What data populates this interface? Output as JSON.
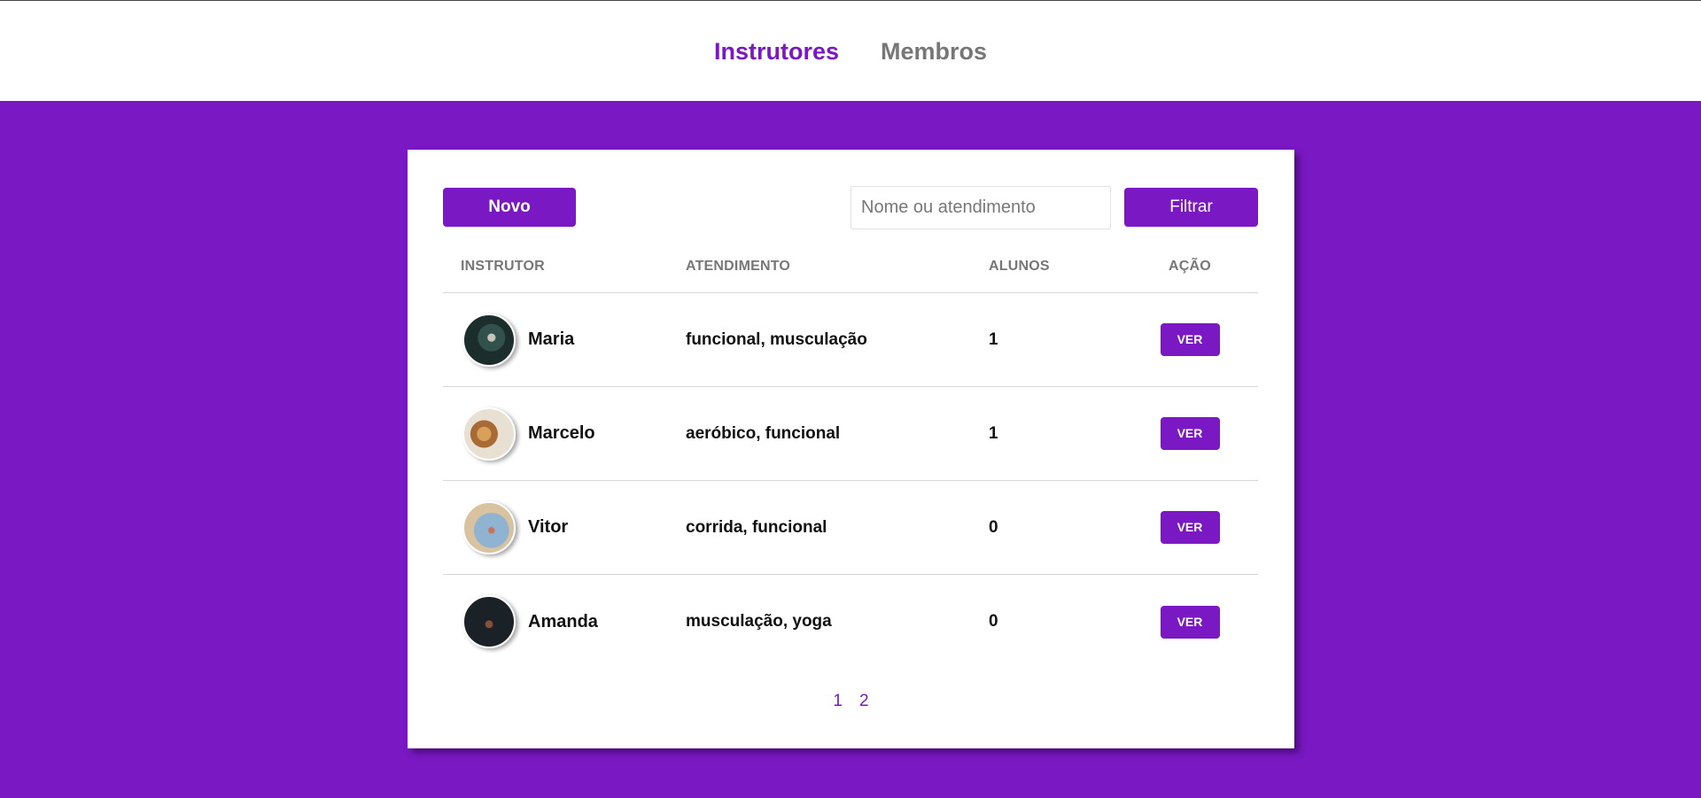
{
  "nav": {
    "items": [
      {
        "label": "Instrutores",
        "active": true
      },
      {
        "label": "Membros",
        "active": false
      }
    ]
  },
  "colors": {
    "accent": "#7a18c4",
    "nav_inactive": "#777777"
  },
  "toolbar": {
    "new_label": "Novo",
    "search_placeholder": "Nome ou atendimento",
    "search_value": "",
    "filter_label": "Filtrar"
  },
  "table": {
    "headers": [
      "Instrutor",
      "Atendimento",
      "Alunos",
      "Ação"
    ],
    "rows": [
      {
        "name": "Maria",
        "services": "funcional, musculação",
        "students": "1",
        "action": "VER",
        "avatar": "avatar-photo"
      },
      {
        "name": "Marcelo",
        "services": "aeróbico, funcional",
        "students": "1",
        "action": "VER",
        "avatar": "avatar-photo"
      },
      {
        "name": "Vitor",
        "services": "corrida, funcional",
        "students": "0",
        "action": "VER",
        "avatar": "avatar-photo"
      },
      {
        "name": "Amanda",
        "services": "musculação, yoga",
        "students": "0",
        "action": "VER",
        "avatar": "avatar-photo"
      }
    ]
  },
  "pagination": {
    "pages": [
      "1",
      "2"
    ]
  }
}
